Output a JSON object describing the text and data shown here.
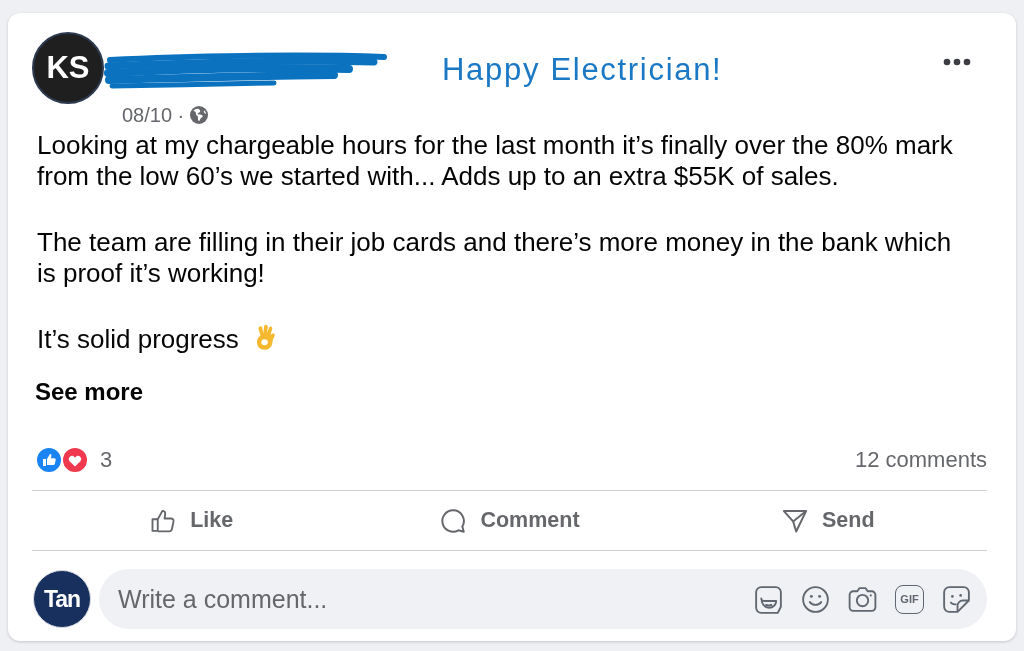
{
  "post": {
    "author_initials": "KS",
    "headline": "Happy Electrician!",
    "date": "08/10 ·",
    "paragraphs": [
      {
        "kind": "plain",
        "lines": [
          "Looking at my chargeable hours for the last month it’s finally over the 80% mark",
          "from the low 60’s we started with... Adds up to an extra $55K of sales."
        ]
      },
      {
        "kind": "plain",
        "lines": [
          "The team are filling in their job cards and there’s more money in the bank which",
          "is proof it’s working!"
        ]
      },
      {
        "kind": "emoji",
        "lines": [
          "It’s solid progress"
        ]
      }
    ],
    "see_more": "See more",
    "reactions": [
      {
        "kind": "like"
      },
      {
        "kind": "love"
      }
    ],
    "reaction_count": "3",
    "comments_count": "12 comments",
    "actions": [
      {
        "kind": "like",
        "label": "Like"
      },
      {
        "kind": "comment",
        "label": "Comment"
      },
      {
        "kind": "send",
        "label": "Send"
      }
    ]
  },
  "comment_box": {
    "avatar_text": "Tan",
    "placeholder": "Write a comment...",
    "tools": [
      {
        "kind": "avatar_sticker"
      },
      {
        "kind": "emoji"
      },
      {
        "kind": "camera"
      },
      {
        "kind": "gif",
        "label": "GIF"
      },
      {
        "kind": "sticker"
      }
    ]
  }
}
